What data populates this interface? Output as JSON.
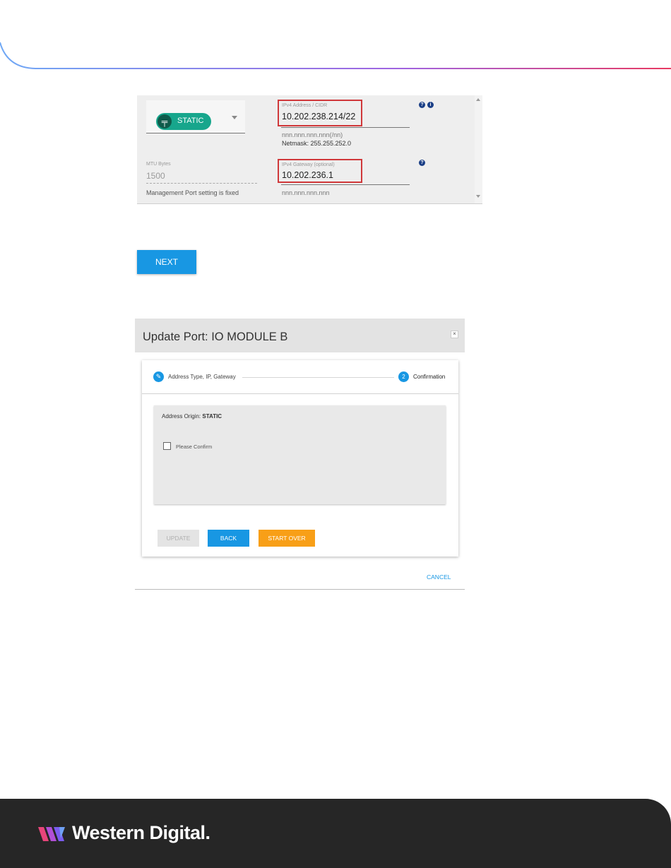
{
  "colors": {
    "accent_blue": "#1897e3",
    "static_chip_green": "#17a68c",
    "highlight_red": "#d0383a",
    "start_over_orange": "#f89f17",
    "footer_bg": "#262626",
    "header_gradient": [
      "#6fa8f5",
      "#a063e0",
      "#e83a62"
    ]
  },
  "icons": {
    "chip": "static-ip-icon",
    "help": "question-circle-icon",
    "info": "info-circle-icon",
    "edit": "pencil-icon",
    "close": "close-icon"
  },
  "ip_form": {
    "address_type": "STATIC",
    "ipv4_address": {
      "label": "IPv4 Address / CIDR",
      "value": "10.202.238.214/22",
      "format_hint": "nnn.nnn.nnn.nnn(/nn)",
      "netmask": "Netmask: 255.255.252.0"
    },
    "mtu": {
      "label": "MTU Bytes",
      "value": "1500",
      "note": "Management Port setting is fixed"
    },
    "ipv4_gateway": {
      "label": "IPv4 Gateway (optional)",
      "value": "10.202.236.1",
      "format_hint": "nnn.nnn.nnn.nnn"
    }
  },
  "next_button": "NEXT",
  "dialog": {
    "title": "Update Port: IO MODULE B",
    "close": "×",
    "steps": [
      {
        "label": "Address Type, IP, Gateway",
        "icon": "pencil-icon"
      },
      {
        "number": "2",
        "label": "Confirmation"
      }
    ],
    "address_origin_label": "Address Origin:",
    "address_origin_value": "STATIC",
    "confirm_label": "Please Confirm",
    "buttons": {
      "update": "UPDATE",
      "back": "BACK",
      "start_over": "START OVER"
    },
    "cancel": "CANCEL"
  },
  "footer": {
    "brand": "Western Digital."
  }
}
